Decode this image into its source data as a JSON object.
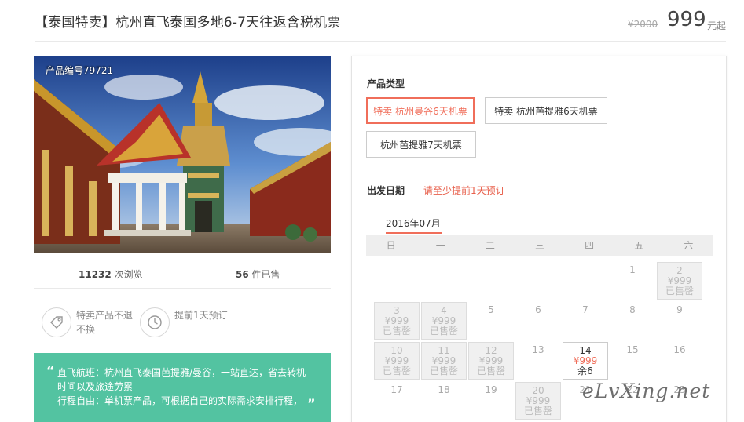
{
  "header": {
    "title": "【泰国特卖】杭州直飞泰国多地6-7天往返含税机票",
    "original_price": "¥2000",
    "price": "999",
    "price_unit": "元起"
  },
  "photo": {
    "product_no": "产品编号79721"
  },
  "stats": {
    "views_count": "11232",
    "views_label": "次浏览",
    "sold_count": "56",
    "sold_label": "件已售"
  },
  "features": [
    {
      "icon": "tag-icon",
      "text": "特卖产品不退不换"
    },
    {
      "icon": "clock-icon",
      "text": "提前1天预订"
    }
  ],
  "notes": {
    "line1": "直飞航班：杭州直飞泰国芭提雅/曼谷，一站直达，省去转机时间以及旅途劳累",
    "line2": "行程自由：单机票产品，可根据自己的实际需求安排行程，"
  },
  "booking": {
    "type_label": "产品类型",
    "options": [
      {
        "label": "特卖 杭州曼谷6天机票",
        "active": true
      },
      {
        "label": "特卖 杭州芭提雅6天机票",
        "active": false
      },
      {
        "label": "杭州芭提雅7天机票",
        "active": false
      }
    ],
    "date_label": "出发日期",
    "date_hint": "请至少提前1天预订",
    "month": "2016年07月",
    "weekdays": [
      "日",
      "一",
      "二",
      "三",
      "四",
      "五",
      "六"
    ],
    "sold_out": "已售罄",
    "cell_price": "¥999",
    "days": [
      {
        "day": "1",
        "status": "none"
      },
      {
        "day": "2",
        "status": "soldout"
      },
      {
        "day": "3",
        "status": "soldout"
      },
      {
        "day": "4",
        "status": "soldout"
      },
      {
        "day": "5",
        "status": "none"
      },
      {
        "day": "6",
        "status": "none"
      },
      {
        "day": "7",
        "status": "none"
      },
      {
        "day": "8",
        "status": "none"
      },
      {
        "day": "9",
        "status": "none"
      },
      {
        "day": "10",
        "status": "soldout"
      },
      {
        "day": "11",
        "status": "soldout"
      },
      {
        "day": "12",
        "status": "soldout"
      },
      {
        "day": "13",
        "status": "none"
      },
      {
        "day": "14",
        "status": "available",
        "remain": "余6"
      },
      {
        "day": "15",
        "status": "none"
      },
      {
        "day": "16",
        "status": "none"
      },
      {
        "day": "17",
        "status": "none"
      },
      {
        "day": "18",
        "status": "none"
      },
      {
        "day": "19",
        "status": "none"
      },
      {
        "day": "20",
        "status": "soldout"
      },
      {
        "day": "21",
        "status": "none"
      },
      {
        "day": "22",
        "status": "none"
      },
      {
        "day": "23",
        "status": "none"
      }
    ]
  },
  "watermark": "eLvXing.net",
  "colors": {
    "accent": "#f06e5a",
    "green_box": "#53c3a1"
  }
}
